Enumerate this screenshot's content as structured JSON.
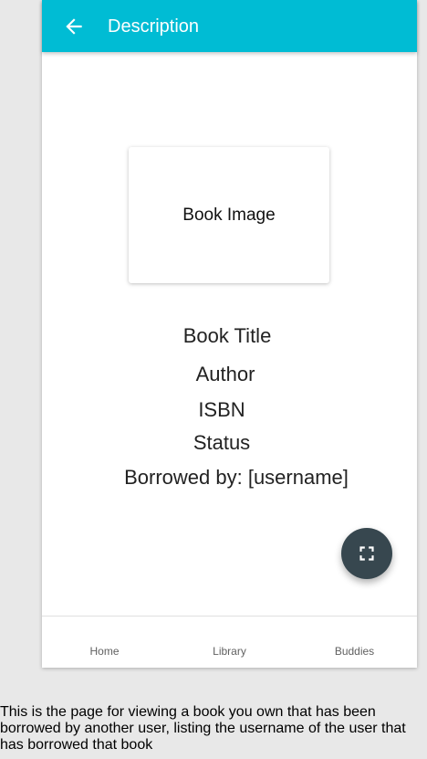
{
  "appbar": {
    "title": "Description",
    "back_icon": "arrow-left-icon",
    "color": "#00bcd4"
  },
  "book": {
    "image_label": "Book Image",
    "title": "Book Title",
    "author": "Author",
    "isbn": "ISBN",
    "status": "Status",
    "borrowed_by": "Borrowed by: [username]"
  },
  "fab": {
    "icon": "fullscreen-icon",
    "color": "#37474f"
  },
  "bottom_nav": {
    "items": [
      {
        "label": "Home"
      },
      {
        "label": "Library"
      },
      {
        "label": "Buddies"
      }
    ]
  },
  "caption": "This is the page for viewing a book you own that has been borrowed by another user, listing the username of the user that has borrowed that book"
}
